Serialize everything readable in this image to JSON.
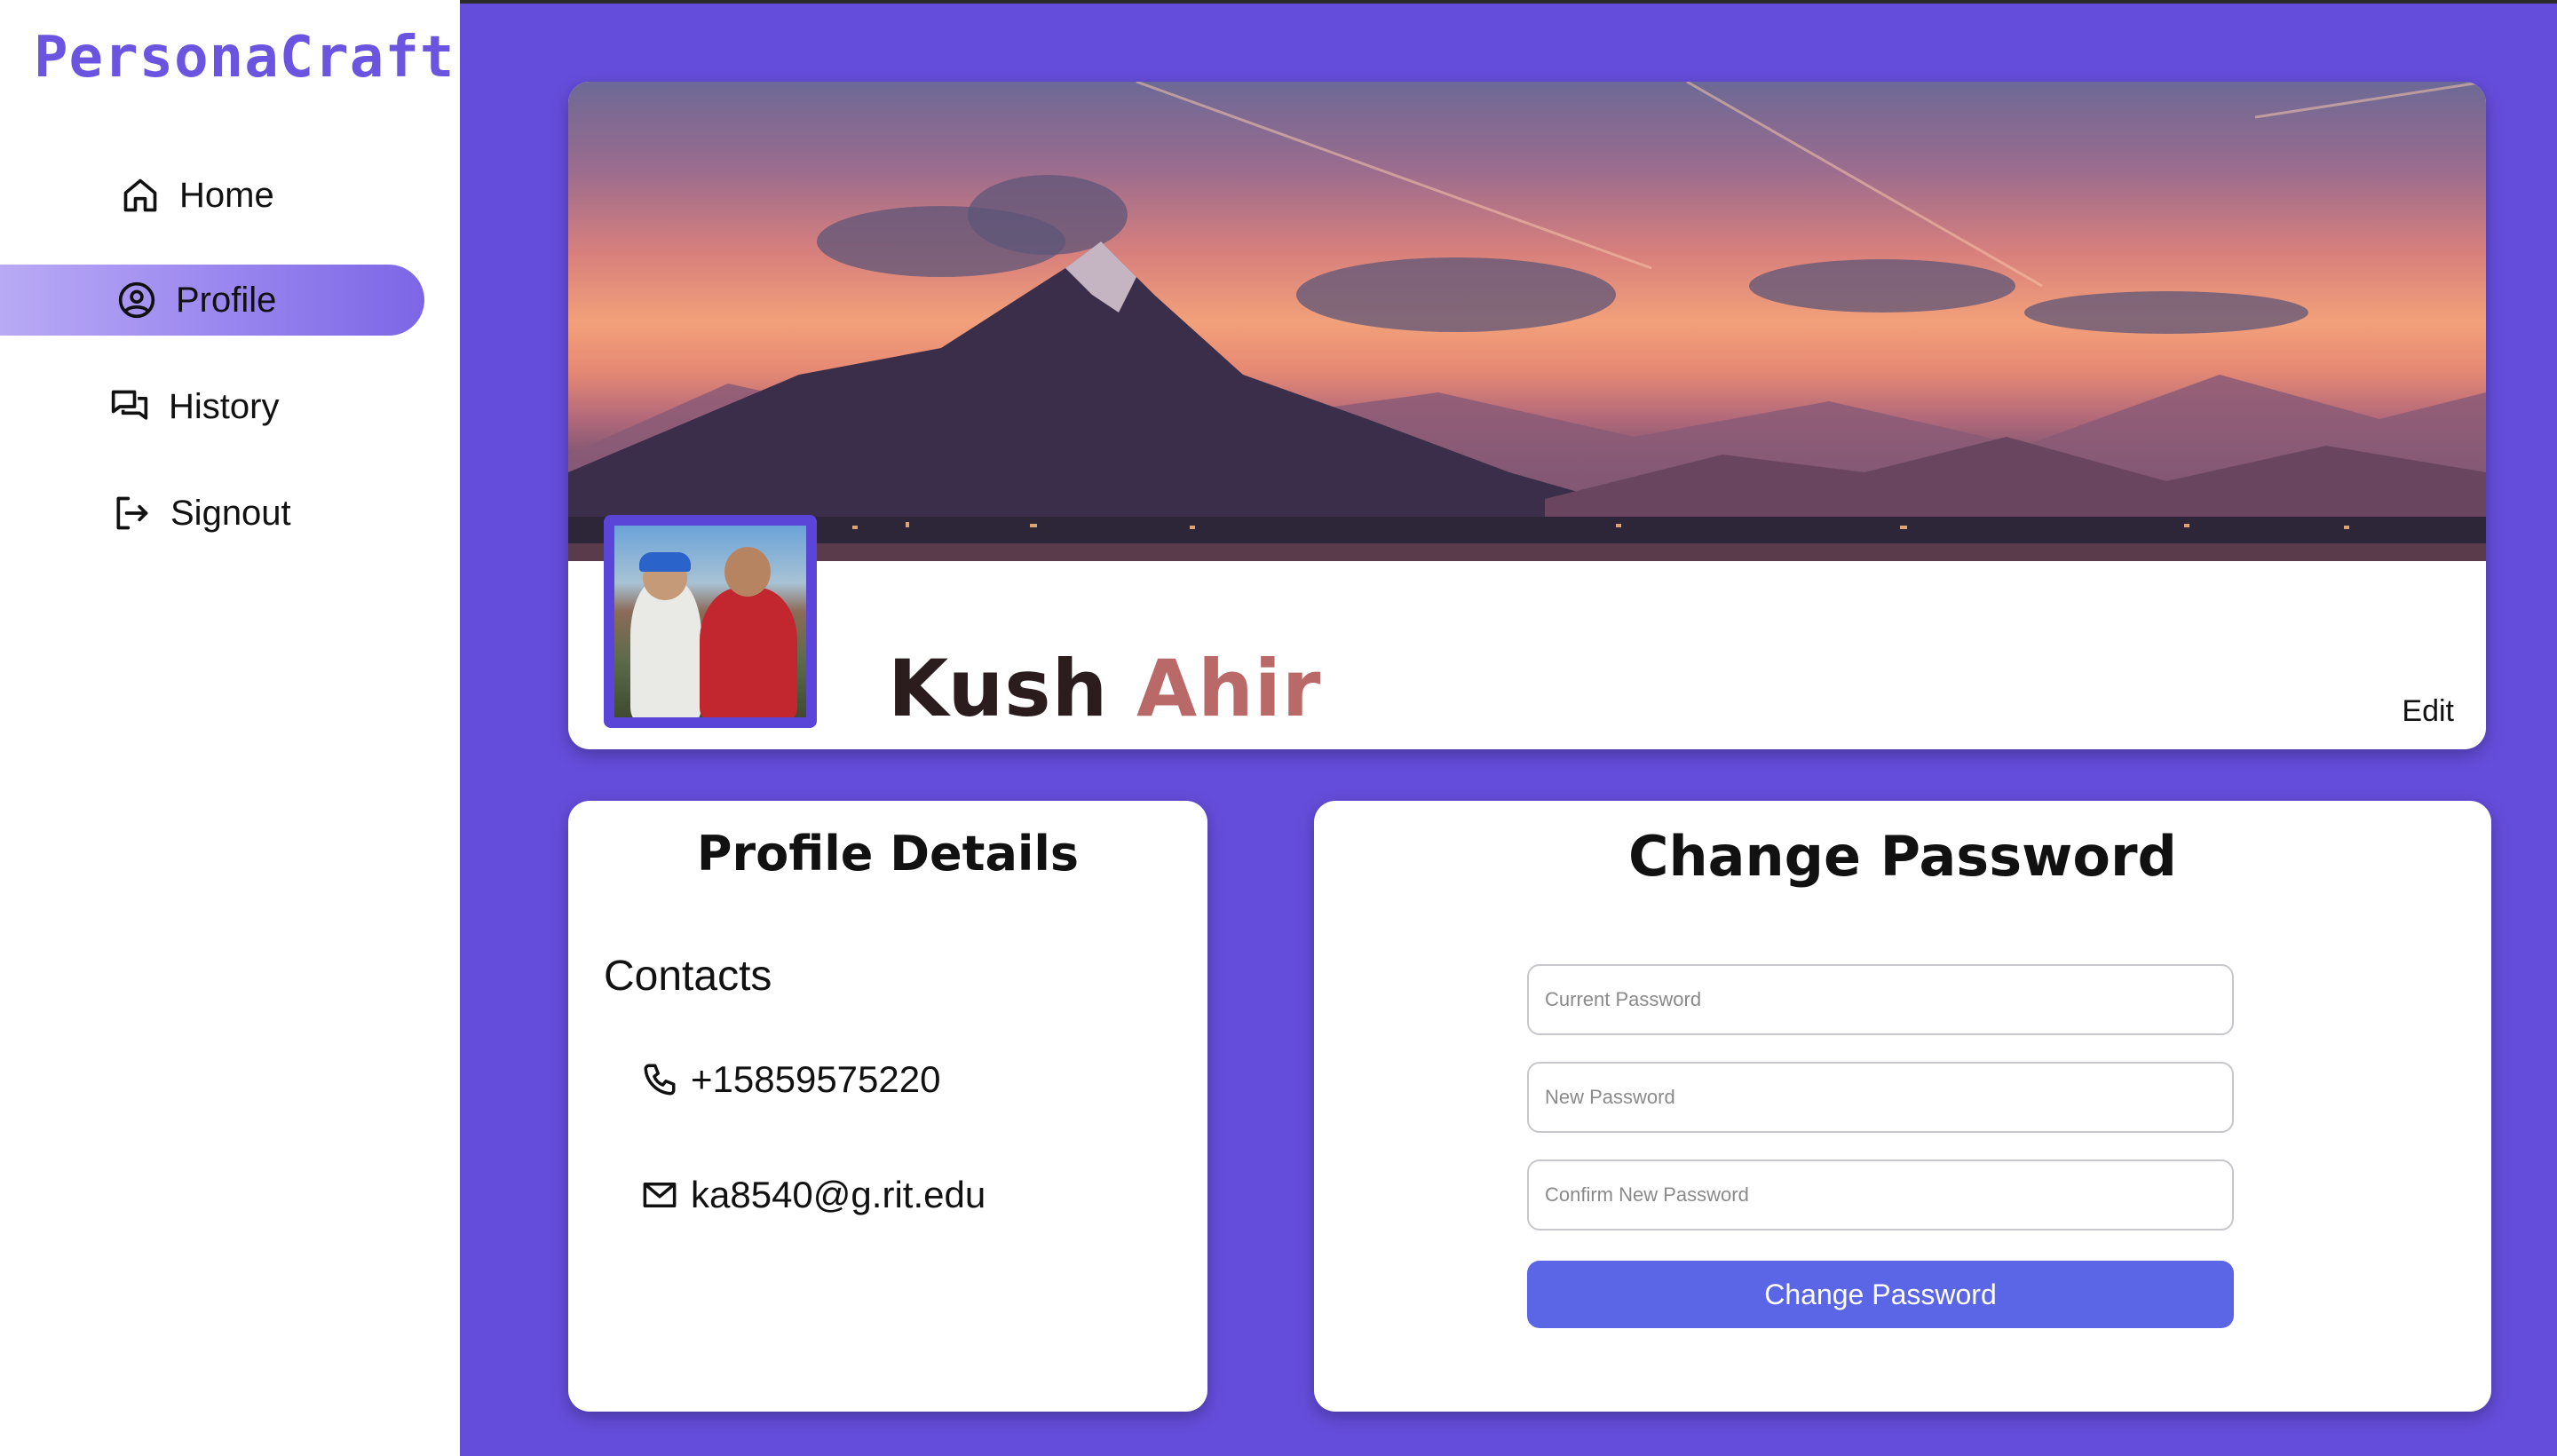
{
  "app": {
    "brand": "PersonaCraft"
  },
  "sidebar": {
    "items": [
      {
        "label": "Home",
        "icon": "home-icon",
        "active": false
      },
      {
        "label": "Profile",
        "icon": "user-circle-icon",
        "active": true
      },
      {
        "label": "History",
        "icon": "chat-bubbles-icon",
        "active": false
      },
      {
        "label": "Signout",
        "icon": "sign-out-icon",
        "active": false
      }
    ]
  },
  "profile": {
    "first_name": "Kush",
    "last_name": "Ahir",
    "edit_label": "Edit"
  },
  "details": {
    "title": "Profile Details",
    "contacts_label": "Contacts",
    "phone": "+15859575220",
    "email": "ka8540@g.rit.edu"
  },
  "password": {
    "title": "Change Password",
    "current_placeholder": "Current Password",
    "new_placeholder": "New Password",
    "confirm_placeholder": "Confirm New Password",
    "button_label": "Change Password"
  },
  "colors": {
    "background": "#654ddb",
    "accent": "#6b55e0",
    "button": "#5a66e6",
    "name_last": "#b96a68"
  }
}
